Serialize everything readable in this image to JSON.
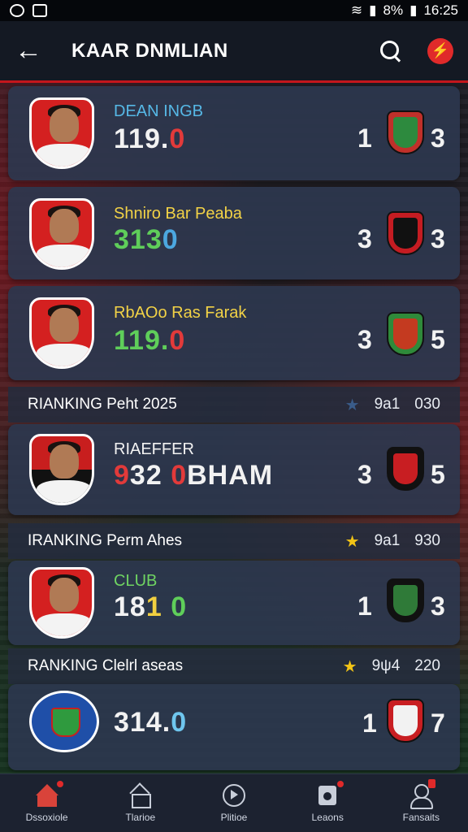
{
  "status_bar": {
    "left_icons": [
      "app-icon",
      "image-icon"
    ],
    "time": "16:25",
    "battery_text": "8%"
  },
  "app_bar": {
    "title": "KAAR DNMLIAN",
    "back_icon": "back-arrow-icon",
    "search_icon": "search-icon",
    "flag_icon": "flag-icon",
    "flag_glyph": "⚡"
  },
  "cards": [
    {
      "name": "DEAN INGB",
      "score_parts": [
        "119.",
        "0"
      ],
      "score_colors": [
        "white",
        "red"
      ],
      "left_num": "1",
      "right_num": "3",
      "name_color": "blue"
    },
    {
      "name": "Shniro Bar Peaba",
      "score_parts": [
        "313",
        "0"
      ],
      "score_colors": [
        "green",
        "blue"
      ],
      "left_num": "3",
      "right_num": "3",
      "name_color": "yellow"
    },
    {
      "name": "RbAOo Ras Farak",
      "score_parts": [
        "119.",
        "0"
      ],
      "score_colors": [
        "green",
        "red"
      ],
      "left_num": "3",
      "right_num": "5",
      "name_color": "yellow"
    },
    {
      "name": "RIAEFFER",
      "score_parts": [
        "9",
        "32",
        "0",
        "BHAM"
      ],
      "score_colors": [
        "red",
        "white",
        "red",
        "white"
      ],
      "left_num": "3",
      "right_num": "5",
      "name_color": "white"
    },
    {
      "name": "CLUB",
      "score_parts": [
        "18",
        "1",
        "0"
      ],
      "score_colors": [
        "white",
        "yellow",
        "green"
      ],
      "left_num": "1",
      "right_num": "3",
      "name_color": "green"
    },
    {
      "name": "",
      "score_parts": [
        "314.",
        "0"
      ],
      "score_colors": [
        "white",
        "cyan"
      ],
      "left_num": "1",
      "right_num": "7",
      "name_color": "white"
    }
  ],
  "sections": [
    {
      "title": "RIANKING  Peht 2025",
      "star": "blue",
      "right_a": "9a1",
      "right_b": "030"
    },
    {
      "title": "IRANKING   Perm Ahes",
      "star": "gold",
      "right_a": "9a1",
      "right_b": "930"
    },
    {
      "title": "RANKING Clelrl aseas",
      "star": "gold",
      "right_a": "9ψ4",
      "right_b": "220"
    }
  ],
  "bottom_nav": [
    {
      "label": "Dssoxiole",
      "icon": "home-icon",
      "active": true
    },
    {
      "label": "Tlarioe",
      "icon": "house-icon",
      "active": false
    },
    {
      "label": "Plitioe",
      "icon": "play-icon",
      "active": false
    },
    {
      "label": "Leaons",
      "icon": "league-icon",
      "active": false
    },
    {
      "label": "Fansaits",
      "icon": "fans-icon",
      "active": false
    }
  ],
  "colors": {
    "accent": "#c4161c",
    "card": "#2c374e",
    "nav": "#1c2230"
  }
}
